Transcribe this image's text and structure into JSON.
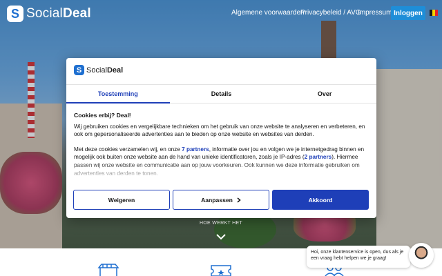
{
  "brand": {
    "name_light": "Social",
    "name_bold": "Deal",
    "logo_glyph": "S",
    "color": "#1e6fd0"
  },
  "nav": {
    "links": [
      "Algemene voorwaarden",
      "Privacybeleid / AVG",
      "Impressum"
    ],
    "login_label": "Inloggen",
    "flag_colors": [
      "#1a1a1a",
      "#f5d300",
      "#e4232b"
    ]
  },
  "hero": {
    "how_it_works": "HOE WERKT HET"
  },
  "modal": {
    "tabs": [
      {
        "label": "Toestemming",
        "active": true
      },
      {
        "label": "Details",
        "active": false
      },
      {
        "label": "Over",
        "active": false
      }
    ],
    "heading": "Cookies erbij? Deal!",
    "para1": "Wij gebruiken cookies en vergelijkbare technieken om het gebruik van onze website te analyseren en verbeteren, en ook om gepersonaliseerde advertenties aan te bieden op onze website en websites van derden.",
    "para2_a": "Met deze cookies verzamelen wij, en onze ",
    "para2_link1": "7 partners",
    "para2_b": ", informatie over jou en volgen we je internetgedrag binnen en mogelijk ook buiten onze website aan de hand van unieke identificatoren, zoals je IP-adres (",
    "para2_link2": "2 partners",
    "para2_c": "). Hiermee passen wij onze website en communicatie aan op jouw voorkeuren. Ook kunnen we deze informatie gebruiken om advertenties van derden te tonen.",
    "buttons": {
      "reject": "Weigeren",
      "customize": "Aanpassen",
      "accept": "Akkoord"
    }
  },
  "chat": {
    "text": "Hoi, onze klantenservice is open, dus als je een vraag hebt helpen we je graag!"
  },
  "accent": "#1e3fb8"
}
